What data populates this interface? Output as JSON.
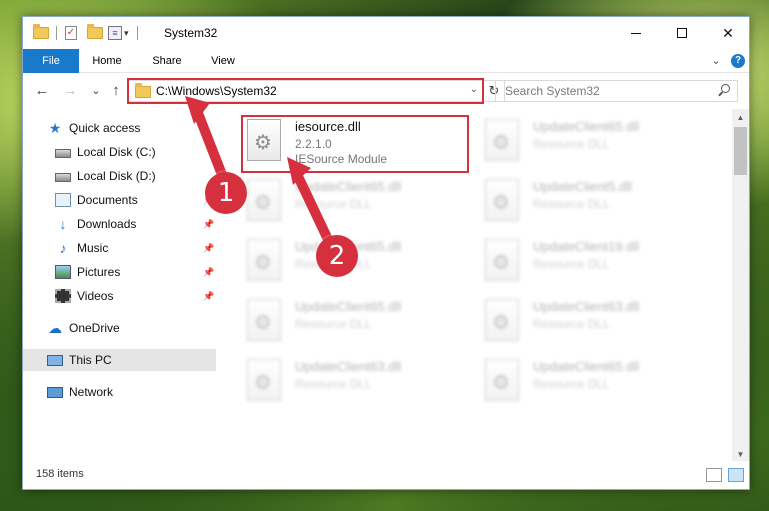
{
  "window": {
    "title": "System32",
    "controls": {
      "minimize": "—",
      "maximize": "☐",
      "close": "✕"
    }
  },
  "quick_access_toolbar": {
    "dropdown": "▾"
  },
  "ribbon": {
    "tabs": [
      {
        "label": "File"
      },
      {
        "label": "Home"
      },
      {
        "label": "Share"
      },
      {
        "label": "View"
      }
    ],
    "expand": "⌄",
    "help": "?"
  },
  "nav": {
    "back": "←",
    "forward": "→",
    "recent": "⌄",
    "up": "↑",
    "address": "C:\\Windows\\System32",
    "address_dropdown": "⌄",
    "refresh": "↻",
    "search_placeholder": "Search System32"
  },
  "sidebar": {
    "items": [
      {
        "label": "Quick access",
        "icon": "star-icon"
      },
      {
        "label": "Local Disk (C:)",
        "icon": "disk-icon",
        "pinned": true
      },
      {
        "label": "Local Disk (D:)",
        "icon": "disk-icon",
        "pinned": true
      },
      {
        "label": "Documents",
        "icon": "documents-icon",
        "pinned": true
      },
      {
        "label": "Downloads",
        "icon": "downloads-icon",
        "pinned": true
      },
      {
        "label": "Music",
        "icon": "music-icon",
        "pinned": true
      },
      {
        "label": "Pictures",
        "icon": "pictures-icon",
        "pinned": true
      },
      {
        "label": "Videos",
        "icon": "videos-icon",
        "pinned": true
      },
      {
        "label": "OneDrive",
        "icon": "cloud-icon"
      },
      {
        "label": "This PC",
        "icon": "pc-icon",
        "selected": true
      },
      {
        "label": "Network",
        "icon": "network-icon"
      }
    ]
  },
  "files": [
    {
      "name": "iesource.dll",
      "version": "2.2.1.0",
      "description": "IESource Module",
      "highlighted": true
    },
    {
      "name": "UpdateClient65.dll",
      "description": "Resource DLL",
      "blurred": true
    },
    {
      "name": "UpdateClient65.dll",
      "description": "Resource DLL",
      "blurred": true
    },
    {
      "name": "UpdateClient5.dll",
      "description": "Resource DLL",
      "blurred": true
    },
    {
      "name": "UpdateClient65.dll",
      "description": "Resource DLL",
      "blurred": true
    },
    {
      "name": "UpdateClient19.dll",
      "description": "Resource DLL",
      "blurred": true
    },
    {
      "name": "UpdateClient65.dll",
      "description": "Resource DLL",
      "blurred": true
    },
    {
      "name": "UpdateClient63.dll",
      "description": "Resource DLL",
      "blurred": true
    },
    {
      "name": "UpdateClient63.dll",
      "description": "Resource DLL",
      "blurred": true
    },
    {
      "name": "UpdateClient65.dll",
      "description": "Resource DLL",
      "blurred": true
    }
  ],
  "status": {
    "item_count": "158 items"
  },
  "callouts": {
    "one": "1",
    "two": "2"
  },
  "colors": {
    "accent": "#1979ca",
    "highlight": "#d6303f",
    "selected_bg": "#e5e5e5"
  }
}
